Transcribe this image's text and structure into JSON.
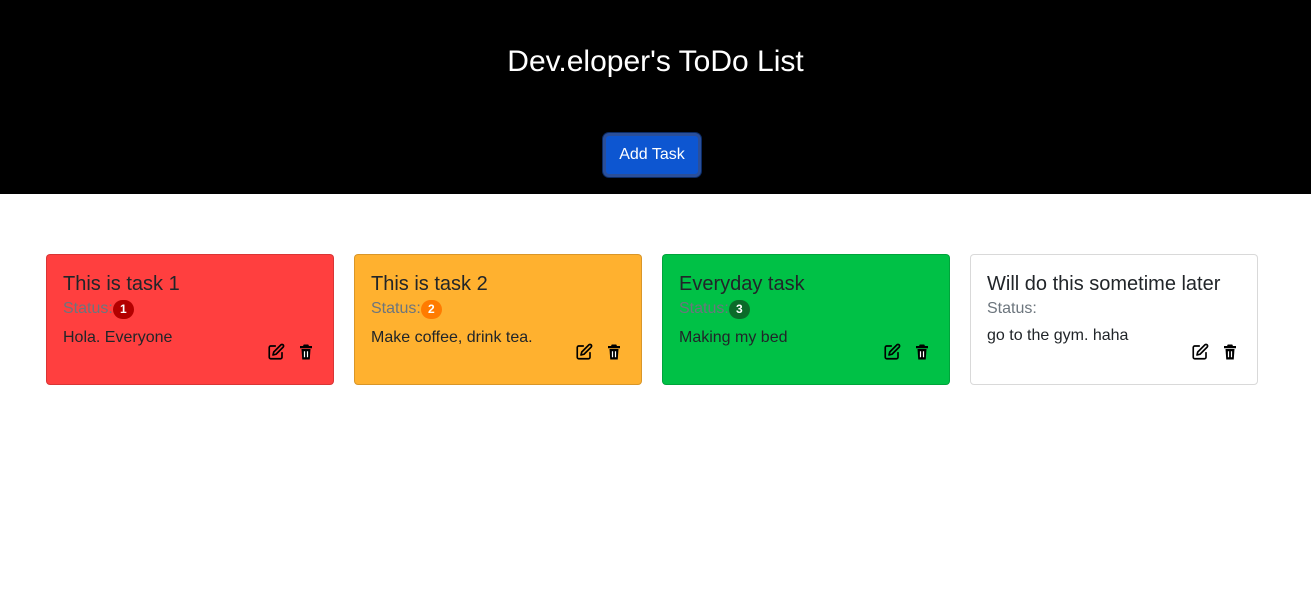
{
  "header": {
    "title": "Dev.eloper's ToDo List",
    "add_button_label": "Add Task"
  },
  "colors": {
    "header_bg": "#000000",
    "add_button_bg": "#0d56d1"
  },
  "tasks": [
    {
      "title": "This is task 1",
      "status_label": "Status:",
      "status_badge": "1",
      "badge_color": "#b30000",
      "card_color": "#ff3f3f",
      "description": "Hola. Everyone",
      "edit_icon": "edit-icon",
      "delete_icon": "trash-icon"
    },
    {
      "title": "This is task 2",
      "status_label": "Status:",
      "status_badge": "2",
      "badge_color": "#ff7b00",
      "card_color": "#ffb12f",
      "description": "Make coffee, drink tea.",
      "edit_icon": "edit-icon",
      "delete_icon": "trash-icon"
    },
    {
      "title": "Everyday task",
      "status_label": "Status:",
      "status_badge": "3",
      "badge_color": "#0b6b2a",
      "card_color": "#00c146",
      "description": "Making my bed",
      "edit_icon": "edit-icon",
      "delete_icon": "trash-icon"
    },
    {
      "title": "Will do this sometime later",
      "status_label": "Status:",
      "status_badge": "",
      "badge_color": "",
      "card_color": "#ffffff",
      "description": "go to the gym. haha",
      "edit_icon": "edit-icon",
      "delete_icon": "trash-icon"
    }
  ]
}
